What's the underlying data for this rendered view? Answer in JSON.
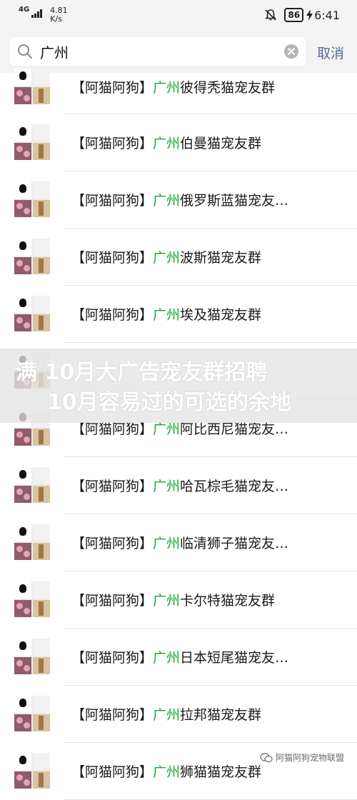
{
  "status_bar": {
    "network": "4G",
    "speed_value": "4.81",
    "speed_unit": "K/s",
    "battery": "86",
    "time": "6:41"
  },
  "search": {
    "value": "广州",
    "cancel_label": "取消"
  },
  "list": [
    {
      "prefix": "【阿猫阿狗】",
      "city": "广州",
      "name": "彼得秃猫宠友群"
    },
    {
      "prefix": "【阿猫阿狗】",
      "city": "广州",
      "name": "伯曼猫宠友群"
    },
    {
      "prefix": "【阿猫阿狗】",
      "city": "广州",
      "name": "俄罗斯蓝猫宠友…"
    },
    {
      "prefix": "【阿猫阿狗】",
      "city": "广州",
      "name": "波斯猫宠友群"
    },
    {
      "prefix": "【阿猫阿狗】",
      "city": "广州",
      "name": "埃及猫宠友群"
    },
    {
      "prefix": "",
      "city": "",
      "name": ""
    },
    {
      "prefix": "【阿猫阿狗】",
      "city": "广州",
      "name": "阿比西尼猫宠友…"
    },
    {
      "prefix": "【阿猫阿狗】",
      "city": "广州",
      "name": "哈瓦棕毛猫宠友…"
    },
    {
      "prefix": "【阿猫阿狗】",
      "city": "广州",
      "name": "临清狮子猫宠友…"
    },
    {
      "prefix": "【阿猫阿狗】",
      "city": "广州",
      "name": "卡尔特猫宠友群"
    },
    {
      "prefix": "【阿猫阿狗】",
      "city": "广州",
      "name": "日本短尾猫宠友…"
    },
    {
      "prefix": "【阿猫阿狗】",
      "city": "广州",
      "name": "拉邦猫宠友群"
    },
    {
      "prefix": "【阿猫阿狗】",
      "city": "广州",
      "name": "狮猫猫宠友群"
    }
  ],
  "overlay": {
    "line1": "满 10月大广告宠友群招聘",
    "line2": "10月容易过的可选的余地"
  },
  "watermark": {
    "text": "阿猫阿狗宠物联盟"
  },
  "colors": {
    "city_green": "#14a832",
    "cancel_blue": "#586b97",
    "bar_bg": "#f3f3f3"
  }
}
